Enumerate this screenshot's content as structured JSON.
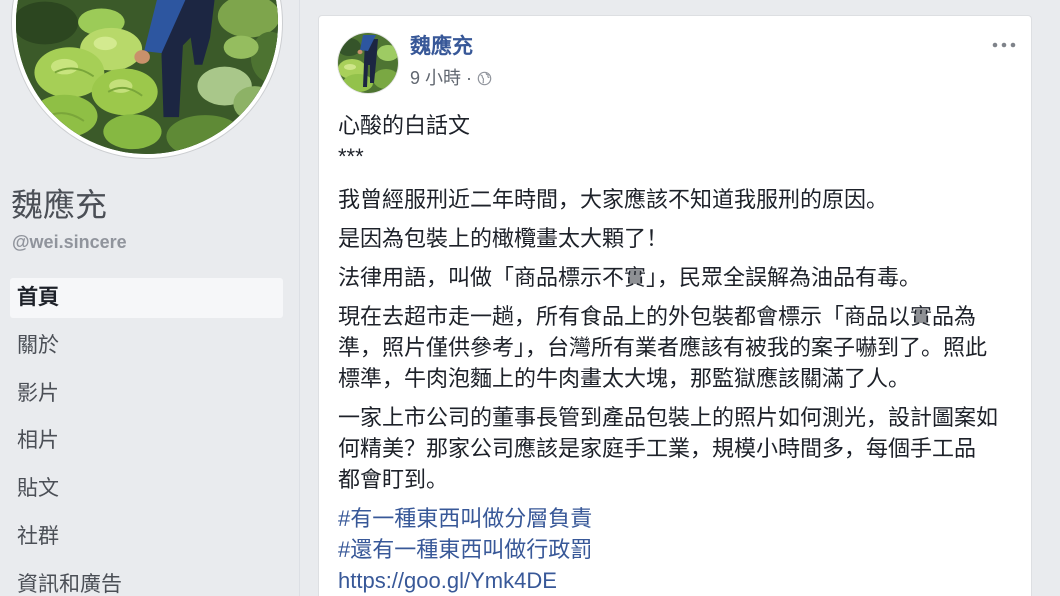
{
  "sidebar": {
    "page_name": "魏應充",
    "handle": "@wei.sincere",
    "nav": [
      {
        "label": "首頁",
        "selected": true
      },
      {
        "label": "關於",
        "selected": false
      },
      {
        "label": "影片",
        "selected": false
      },
      {
        "label": "相片",
        "selected": false
      },
      {
        "label": "貼文",
        "selected": false
      },
      {
        "label": "社群",
        "selected": false
      },
      {
        "label": "資訊和廣告",
        "selected": false
      }
    ]
  },
  "post": {
    "author": "魏應充",
    "time": "9 小時",
    "separator": "·",
    "privacy_icon": "globe-icon",
    "menu_icon": "more-options-icon",
    "paragraphs": [
      {
        "lines": [
          "心酸的白話文",
          "***"
        ]
      },
      {
        "lines": [
          "我曾經服刑近二年時間，大家應該不知道我服刑的原因。"
        ]
      },
      {
        "lines": [
          "是因為包裝上的橄欖畫太大顆了！"
        ]
      },
      {
        "lines": [
          "法律用語，叫做「商品標示不實」，民眾全誤解為油品有毒。"
        ]
      },
      {
        "lines": [
          "現在去超市走一趟，所有食品上的外包裝都會標示「商品以實品為",
          "準，照片僅供參考」，台灣所有業者應該有被我的案子嚇到了。照此",
          "標準，牛肉泡麵上的牛肉畫太大塊，那監獄應該關滿了人。"
        ]
      },
      {
        "lines": [
          "一家上市公司的董事長管到產品包裝上的照片如何測光，設計圖案如",
          "何精美？那家公司應該是家庭手工業，規模小時間多，每個手工品",
          "都會盯到。"
        ]
      }
    ],
    "hashtags": [
      "#有一種東西叫做分層負責",
      "#還有一種東西叫做行政罰"
    ],
    "link": "https://goo.gl/Ymk4DE"
  },
  "colors": {
    "page_background": "#e9ebee",
    "text": "#1d2129",
    "secondary_text": "#4b4f56",
    "muted_text": "#90949c",
    "timestamp": "#616770",
    "link": "#385898",
    "card_border": "#dddfe2",
    "selected_nav_background": "#f6f7f9",
    "icon_gray": "#7f838a"
  }
}
